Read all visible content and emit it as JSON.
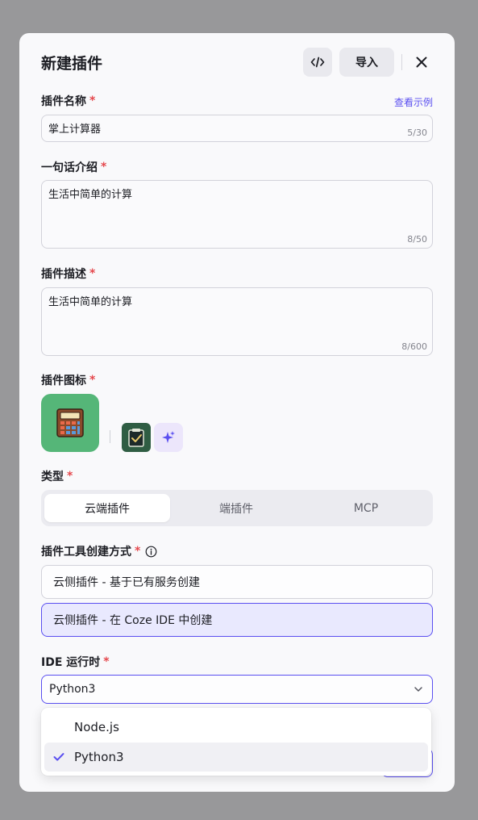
{
  "header": {
    "title": "新建插件",
    "code_icon": "code-icon",
    "import_label": "导入",
    "close_icon": "close-icon"
  },
  "plugin_name": {
    "label": "插件名称",
    "required_mark": "*",
    "example_link": "查看示例",
    "value": "掌上计算器",
    "counter": "5/30"
  },
  "intro": {
    "label": "一句话介绍",
    "required_mark": "*",
    "value": "生活中简单的计算",
    "counter": "8/50"
  },
  "description": {
    "label": "插件描述",
    "required_mark": "*",
    "value": "生活中简单的计算",
    "counter": "8/600"
  },
  "icon_section": {
    "label": "插件图标",
    "required_mark": "*",
    "main_icon": "calculator-icon",
    "alt_icon": "notepad-check-icon",
    "ai_icon": "ai-sparkle-icon"
  },
  "type_section": {
    "label": "类型",
    "required_mark": "*",
    "tabs": [
      "云端插件",
      "端插件",
      "MCP"
    ],
    "active_tab": "云端插件"
  },
  "creation_method": {
    "label": "插件工具创建方式",
    "required_mark": "*",
    "info_icon": "info-icon",
    "options": [
      "云侧插件 - 基于已有服务创建",
      "云侧插件 - 在 Coze IDE 中创建"
    ],
    "selected": "云侧插件 - 在 Coze IDE 中创建"
  },
  "ide_runtime": {
    "label": "IDE 运行时",
    "required_mark": "*",
    "value": "Python3",
    "chevron_icon": "chevron-down-icon",
    "options": [
      "Node.js",
      "Python3"
    ],
    "selected": "Python3",
    "check_icon": "check-icon"
  },
  "colors": {
    "accent": "#5a4ff0",
    "required": "#e5484d",
    "icon_bg": "#55b678"
  }
}
